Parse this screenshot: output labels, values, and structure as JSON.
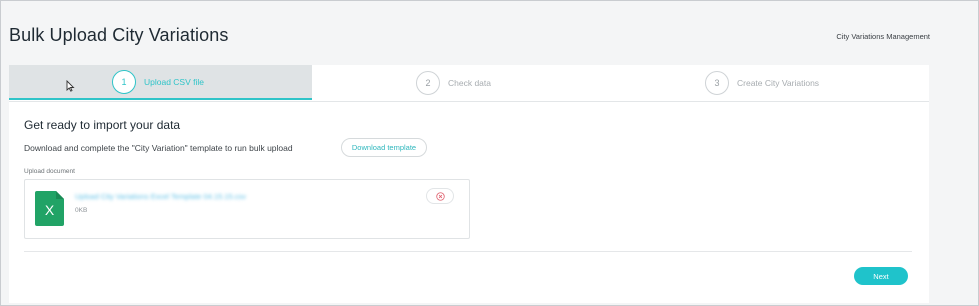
{
  "header": {
    "title": "Bulk Upload City Variations",
    "breadcrumb": "City Variations Management"
  },
  "stepper": {
    "steps": [
      {
        "number": "1",
        "label": "Upload CSV file",
        "state": "active"
      },
      {
        "number": "2",
        "label": "Check data",
        "state": "inactive"
      },
      {
        "number": "3",
        "label": "Create City Variations",
        "state": "inactive"
      }
    ]
  },
  "main": {
    "heading": "Get ready to import your data",
    "instruction": "Download and complete the \"City Variation\" template to run bulk upload",
    "download_button": "Download template",
    "upload_label": "Upload document",
    "file": {
      "name": "Upload City Variations Excel Template 04.15.15.csv",
      "size": "0KB",
      "icon": "excel-file-icon"
    },
    "next_button": "Next"
  },
  "colors": {
    "accent": "#2fc4c8",
    "excel_green": "#21a366",
    "remove_red": "#e0616f"
  }
}
